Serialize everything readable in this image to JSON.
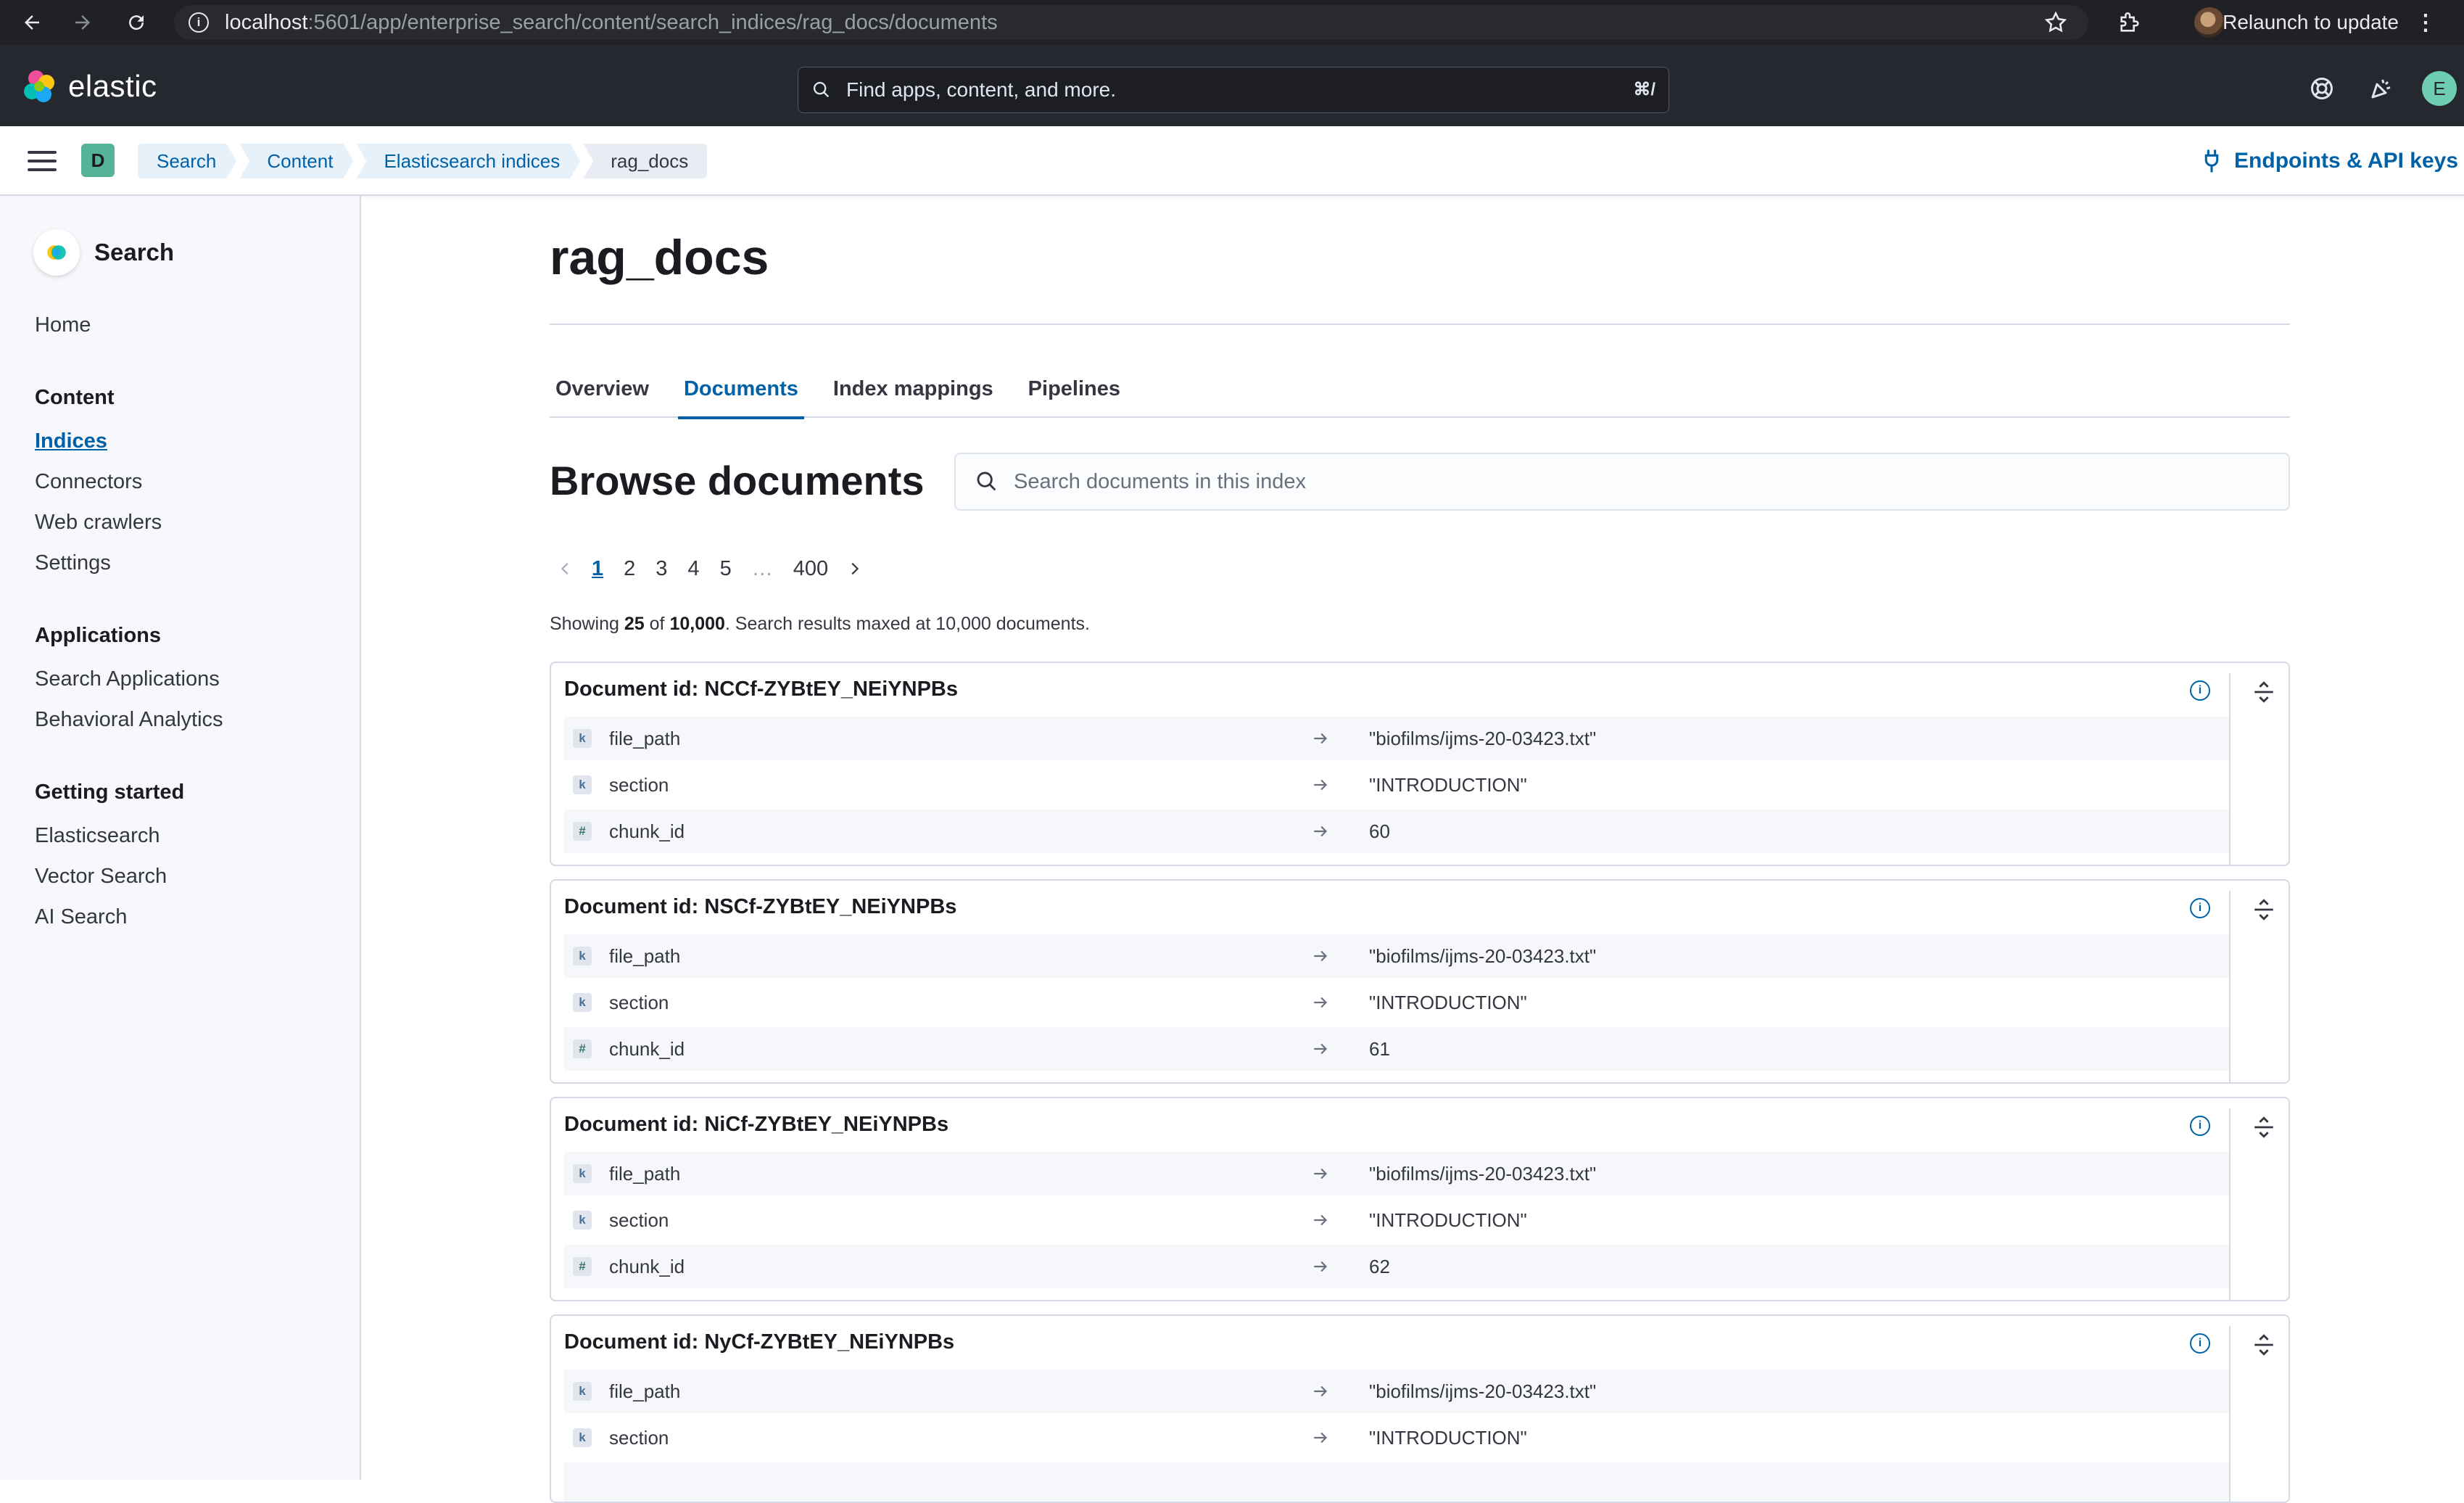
{
  "browser": {
    "url_host": "localhost",
    "url_rest": ":5601/app/enterprise_search/content/search_indices/rag_docs/documents",
    "relaunch_label": "Relaunch to update"
  },
  "header": {
    "logo_text": "elastic",
    "search_placeholder": "Find apps, content, and more.",
    "search_shortcut": "⌘/",
    "user_initial": "E",
    "space_initial": "D",
    "breadcrumbs": [
      "Search",
      "Content",
      "Elasticsearch indices",
      "rag_docs"
    ],
    "endpoints_label": "Endpoints & API keys"
  },
  "sidenav": {
    "title": "Search",
    "home": "Home",
    "groups": [
      {
        "label": "Content",
        "items": [
          "Indices",
          "Connectors",
          "Web crawlers",
          "Settings"
        ]
      },
      {
        "label": "Applications",
        "items": [
          "Search Applications",
          "Behavioral Analytics"
        ]
      },
      {
        "label": "Getting started",
        "items": [
          "Elasticsearch",
          "Vector Search",
          "AI Search"
        ]
      }
    ]
  },
  "main": {
    "title": "rag_docs",
    "tabs": [
      "Overview",
      "Documents",
      "Index mappings",
      "Pipelines"
    ],
    "active_tab": "Documents",
    "browse_title": "Browse documents",
    "search_placeholder": "Search documents in this index",
    "pagination": {
      "pages": [
        "1",
        "2",
        "3",
        "4",
        "5",
        "…",
        "400"
      ],
      "current": "1"
    },
    "showing": {
      "prefix": "Showing",
      "count": "25",
      "of": "of",
      "total": "10,000",
      "suffix": ". Search results maxed at 10,000 documents."
    },
    "documents": [
      {
        "title": "Document id: NCCf-ZYBtEY_NEiYNPBs",
        "fields": [
          {
            "type": "k",
            "name": "file_path",
            "value": "\"biofilms/ijms-20-03423.txt\""
          },
          {
            "type": "#",
            "name": "section",
            "value": "\"INTRODUCTION\""
          },
          {
            "type": "#",
            "name": "chunk_id",
            "value": "60"
          }
        ]
      },
      {
        "title": "Document id: NSCf-ZYBtEY_NEiYNPBs",
        "fields": [
          {
            "type": "k",
            "name": "file_path",
            "value": "\"biofilms/ijms-20-03423.txt\""
          },
          {
            "type": "k",
            "name": "section",
            "value": "\"INTRODUCTION\""
          },
          {
            "type": "#",
            "name": "chunk_id",
            "value": "61"
          }
        ]
      },
      {
        "title": "Document id: NiCf-ZYBtEY_NEiYNPBs",
        "fields": [
          {
            "type": "k",
            "name": "file_path",
            "value": "\"biofilms/ijms-20-03423.txt\""
          },
          {
            "type": "k",
            "name": "section",
            "value": "\"INTRODUCTION\""
          },
          {
            "type": "#",
            "name": "chunk_id",
            "value": "62"
          }
        ]
      },
      {
        "title": "Document id: NyCf-ZYBtEY_NEiYNPBs",
        "fields": [
          {
            "type": "k",
            "name": "file_path",
            "value": "\"biofilms/ijms-20-03423.txt\""
          },
          {
            "type": "k",
            "name": "section",
            "value": "\"INTRODUCTION\""
          }
        ]
      }
    ]
  },
  "colors": {
    "accent": "#0061a6",
    "header_bg": "#25282f",
    "space_badge": "#54b399",
    "avatar": "#6dccb1"
  }
}
